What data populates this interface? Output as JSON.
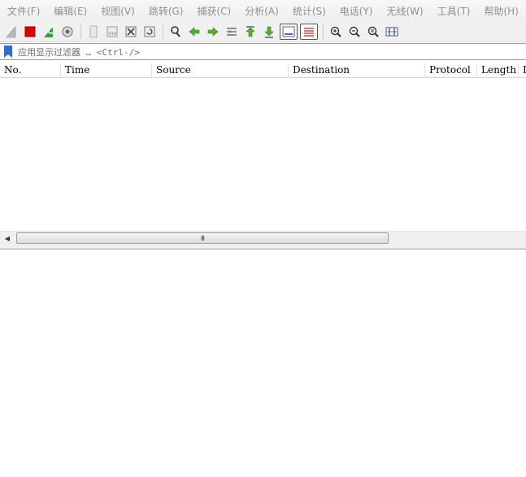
{
  "menu": [
    "文件(F)",
    "编辑(E)",
    "视图(V)",
    "跳转(G)",
    "捕获(C)",
    "分析(A)",
    "统计(S)",
    "电话(Y)",
    "无线(W)",
    "工具(T)",
    "帮助(H)"
  ],
  "toolbar": {
    "icons": [
      "shark-fin-start-icon",
      "stop-capture-icon",
      "restart-capture-icon",
      "capture-options-icon",
      "open-file-icon",
      "save-file-icon",
      "close-file-icon",
      "reload-file-icon",
      "find-packet-icon",
      "go-back-icon",
      "go-forward-icon",
      "go-to-packet-icon",
      "go-first-packet-icon",
      "go-last-packet-icon",
      "auto-scroll-icon",
      "colorize-icon",
      "zoom-in-icon",
      "zoom-out-icon",
      "normal-size-icon",
      "resize-columns-icon"
    ]
  },
  "filter": {
    "placeholder": "应用显示过滤器 … <Ctrl-/>",
    "icon": "bookmark-icon"
  },
  "packet_list": {
    "columns": [
      "No.",
      "Time",
      "Source",
      "Destination",
      "Protocol",
      "Length",
      "Info"
    ],
    "rows": []
  },
  "scrollbar": {
    "left_arrow": "◀",
    "grip": "III"
  },
  "colors": {
    "accent_blue": "#2e6fd1",
    "stop_red": "#e00000",
    "restart_green": "#2ea52e",
    "nav_green": "#56b030"
  }
}
